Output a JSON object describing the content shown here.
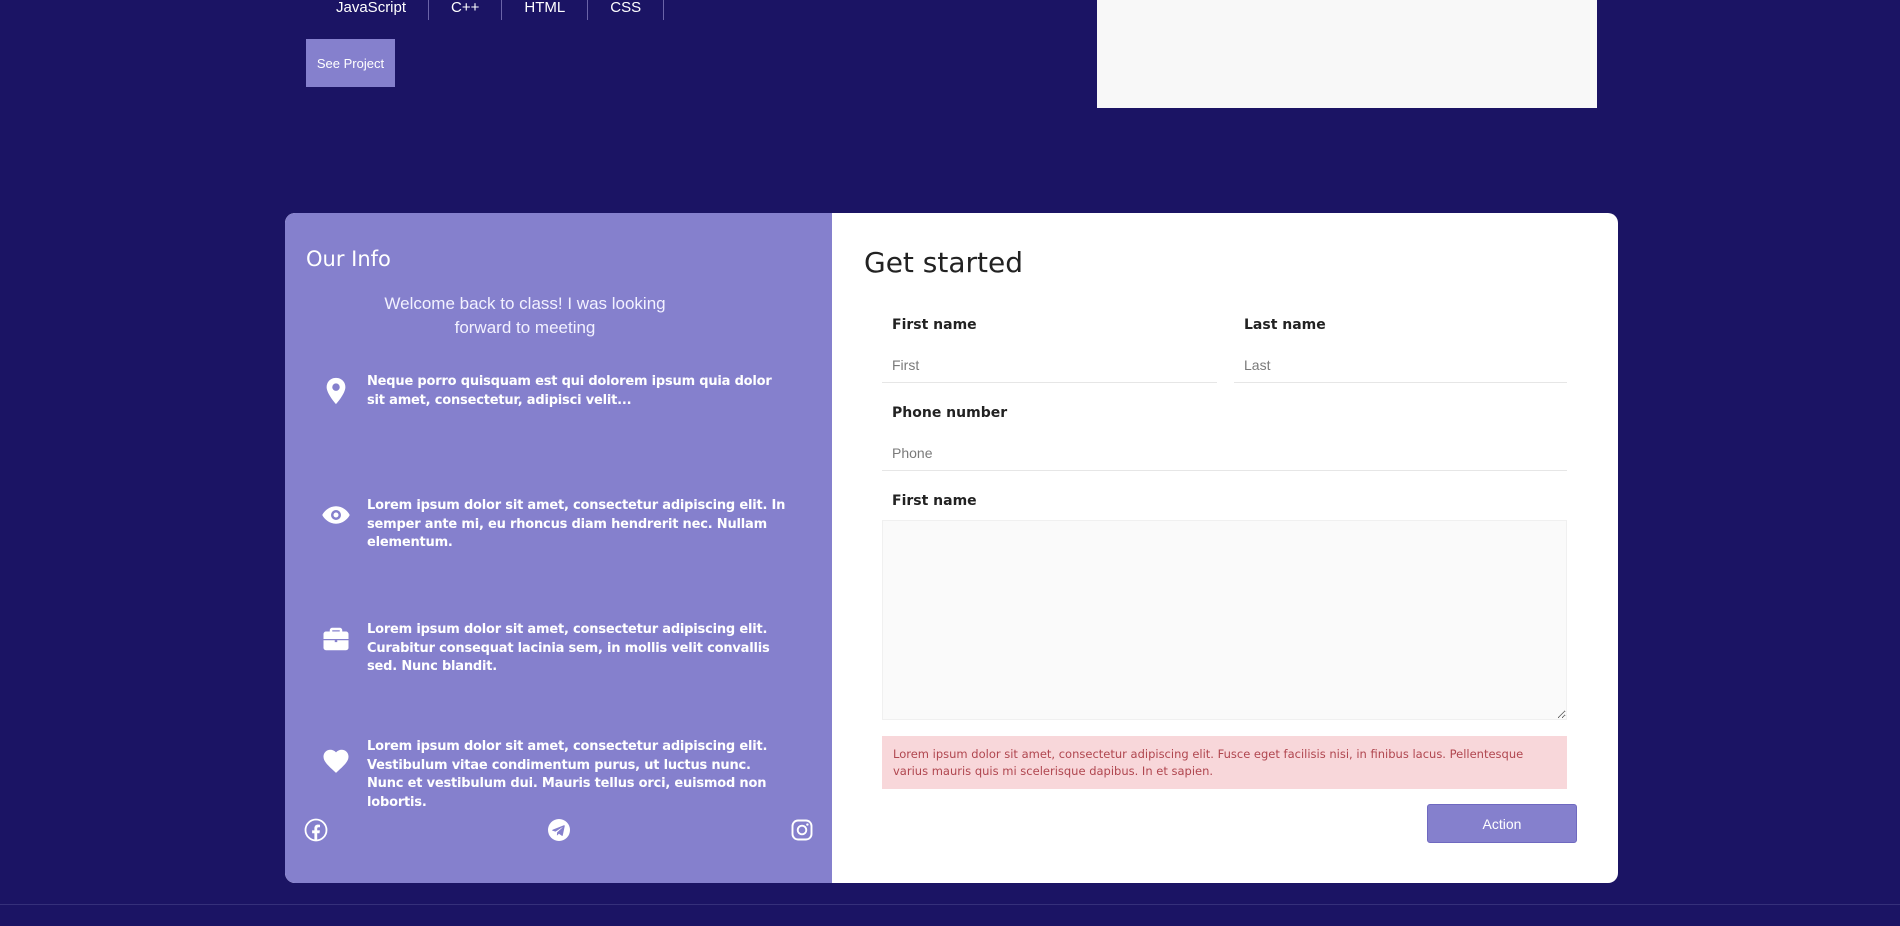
{
  "project": {
    "tags": [
      "JavaScript",
      "C++",
      "HTML",
      "CSS"
    ],
    "see_project": "See Project"
  },
  "info": {
    "title": "Our Info",
    "welcome": "Welcome back to class! I was looking forward to meeting",
    "items": [
      {
        "icon": "location-pin-icon",
        "text": "Neque porro quisquam est qui dolorem ipsum quia dolor sit amet, consectetur, adipisci velit..."
      },
      {
        "icon": "eye-icon",
        "text": "Lorem ipsum dolor sit amet, consectetur adipiscing elit. In semper ante mi, eu rhoncus diam hendrerit nec. Nullam elementum."
      },
      {
        "icon": "briefcase-icon",
        "text": "Lorem ipsum dolor sit amet, consectetur adipiscing elit. Curabitur consequat lacinia sem, in mollis velit convallis sed. Nunc blandit."
      },
      {
        "icon": "heart-icon",
        "text": "Lorem ipsum dolor sit amet, consectetur adipiscing elit. Vestibulum vitae condimentum purus, ut luctus nunc. Nunc et vestibulum dui. Mauris tellus orci, euismod non lobortis."
      }
    ],
    "socials": [
      "facebook-icon",
      "telegram-icon",
      "instagram-icon"
    ]
  },
  "form": {
    "title": "Get started",
    "first_name_label": "First name",
    "first_name_placeholder": "First",
    "last_name_label": "Last name",
    "last_name_placeholder": "Last",
    "phone_label": "Phone number",
    "phone_placeholder": "Phone",
    "message_label": "First name",
    "alert": "Lorem ipsum dolor sit amet, consectetur adipiscing elit. Fusce eget facilisis nisi, in finibus lacus. Pellentesque varius mauris quis mi scelerisque dapibus. In et sapien.",
    "action": "Action"
  },
  "colors": {
    "background": "#1b1464",
    "accent": "#8580cd",
    "alert_bg": "#f8d7da",
    "alert_text": "#b0464f"
  }
}
